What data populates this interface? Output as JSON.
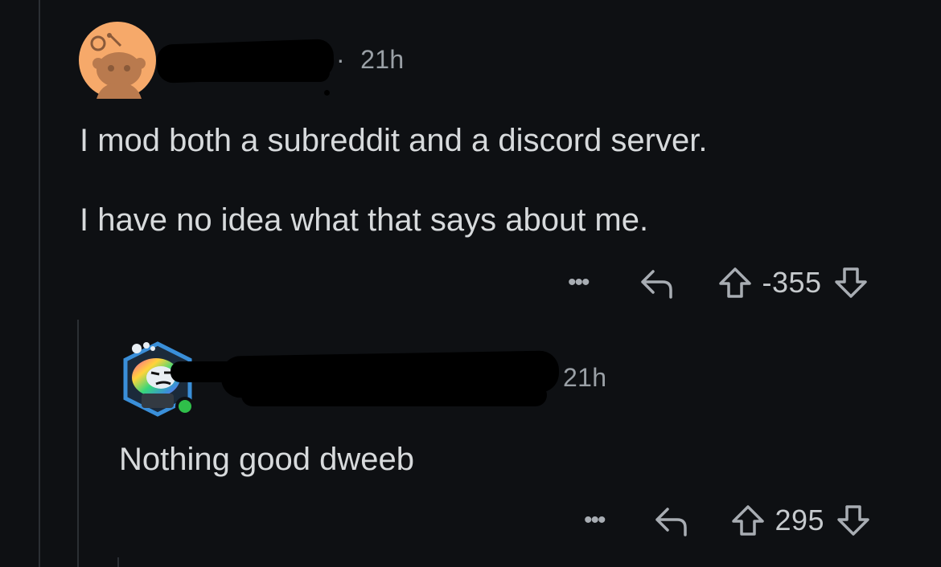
{
  "comments": [
    {
      "username": "",
      "time": "21h",
      "body": [
        "I mod both a subreddit and a discord server.",
        "I have no idea what that says about me."
      ],
      "actions": {
        "more": "•••",
        "score": "-355"
      }
    },
    {
      "username": "",
      "time": "21h",
      "body": [
        "Nothing good dweeb"
      ],
      "actions": {
        "more": "•••",
        "score": "295"
      }
    }
  ],
  "colors": {
    "background": "#0e1013",
    "text": "#d7dadc",
    "muted": "#9aa0a6",
    "avatar1_bg": "#f6a96a",
    "avatar2_frame": "#3a8fd9",
    "online": "#2fbf4a"
  },
  "icons": [
    "reddit-avatar-icon",
    "snoo-avatar-icon",
    "reply-icon",
    "upvote-icon",
    "downvote-icon",
    "more-options-icon"
  ]
}
